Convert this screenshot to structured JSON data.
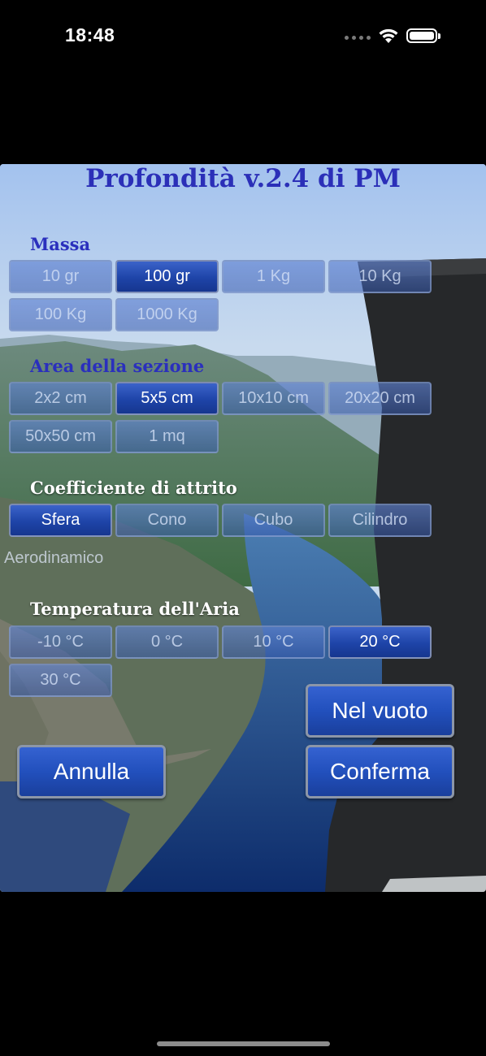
{
  "status_bar": {
    "time": "18:48"
  },
  "title": "Profondità v.2.4 di PM",
  "sections": {
    "massa": "Massa",
    "area": "Area della sezione",
    "coeff": "Coefficiente di attrito",
    "temp": "Temperatura dell'Aria"
  },
  "massa_options": [
    "10 gr",
    "100 gr",
    "1 Kg",
    "10 Kg",
    "100 Kg",
    "1000 Kg"
  ],
  "massa_selected": "100 gr",
  "area_options": [
    "2x2 cm",
    "5x5 cm",
    "10x10 cm",
    "20x20 cm",
    "50x50 cm",
    "1 mq"
  ],
  "area_selected": "5x5 cm",
  "coeff_options": [
    "Sfera",
    "Cono",
    "Cubo",
    "Cilindro",
    "Aerodinamico"
  ],
  "coeff_selected": "Sfera",
  "temp_options": [
    "-10 °C",
    "0 °C",
    "10 °C",
    "20 °C",
    "30 °C"
  ],
  "temp_selected": "20 °C",
  "actions": {
    "vuoto": "Nel vuoto",
    "annulla": "Annulla",
    "conferma": "Conferma"
  }
}
